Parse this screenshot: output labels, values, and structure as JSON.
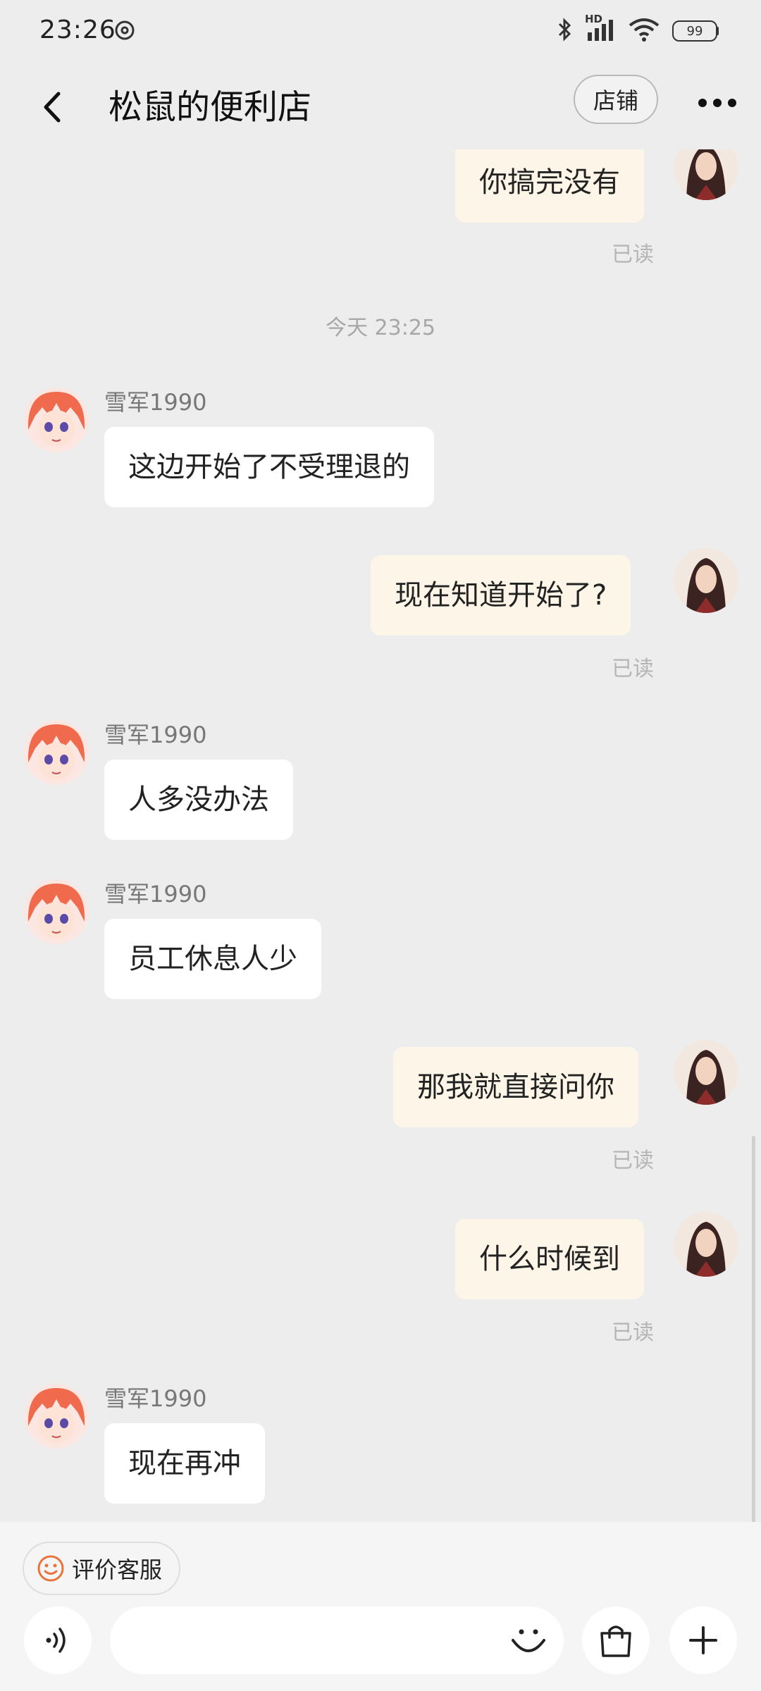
{
  "status": {
    "time": "23:26",
    "battery": "99",
    "network": "HD"
  },
  "header": {
    "title": "松鼠的便利店",
    "shop_label": "店铺"
  },
  "chat": {
    "time_divider": "今天  23:25",
    "messages": [
      {
        "from": "self",
        "text": "你搞完没有",
        "read": "已读"
      },
      {
        "from": "other",
        "sender": "雪军1990",
        "text": "这边开始了不受理退的"
      },
      {
        "from": "self",
        "text": "现在知道开始了?",
        "read": "已读"
      },
      {
        "from": "other",
        "sender": "雪军1990",
        "text": "人多没办法"
      },
      {
        "from": "other",
        "sender": "雪军1990",
        "text": "员工休息人少"
      },
      {
        "from": "self",
        "text": "那我就直接问你",
        "read": "已读"
      },
      {
        "from": "self",
        "text": "什么时候到",
        "read": "已读"
      },
      {
        "from": "other",
        "sender": "雪军1990",
        "text": "现在再冲"
      }
    ]
  },
  "bottom": {
    "rate_label": "评价客服",
    "input_placeholder": ""
  },
  "colors": {
    "self_bubble": "#fdf6e8",
    "other_bubble": "#ffffff",
    "background": "#ededed",
    "rate_icon": "#e8743b"
  }
}
